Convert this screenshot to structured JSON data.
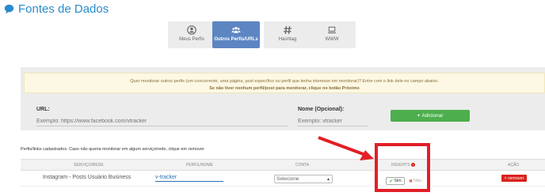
{
  "header": {
    "title": "Fontes de Dados"
  },
  "steps": [
    {
      "label": "Meus Perfis",
      "icon": "user-icon",
      "active": false
    },
    {
      "label": "Outros Perfis/URLs",
      "icon": "users-icon",
      "active": true
    },
    {
      "label": "Hashtag",
      "icon": "hashtag-icon",
      "active": false
    },
    {
      "label": "WWW",
      "icon": "laptop-icon",
      "active": false
    }
  ],
  "notice": {
    "line1": "Quer monitorar outros perfis (um concorrente, uma página, post específico ou perfil que tenha interesse em monitorar)? Entre com o link dele no campo abaixo.",
    "line2": "Se não tiver nenhum perfil/post para monitorar, clique no botão Próximo"
  },
  "form": {
    "url_label": "URL:",
    "url_placeholder": "Exemplo: https://www.facebook.com/vtracker",
    "name_label": "Nome (Opcional):",
    "name_placeholder": "Exemplo: vtracker",
    "add_label": "Adicionar"
  },
  "caption": "Perfis/links cadastrados. Caso não queira monitorar em algum serviço/rede, clique em remover",
  "table": {
    "headers": {
      "service": "SERVIÇO/REDE",
      "profile": "PERFIL/NOME",
      "account": "CONTA",
      "insights": "INSIGHTS",
      "action": "AÇÃO"
    },
    "rows": [
      {
        "service": "Instagram - Posts Usuário Business",
        "profile": "v-tracker",
        "account": "Selecione",
        "insights_yes": "Sim",
        "insights_no": "Não",
        "remove": "remover"
      }
    ]
  },
  "colors": {
    "accent": "#2a8bcc",
    "active_step": "#5c85c2",
    "success": "#4cae4c",
    "danger": "#d9221c",
    "highlight": "#e21f26"
  }
}
